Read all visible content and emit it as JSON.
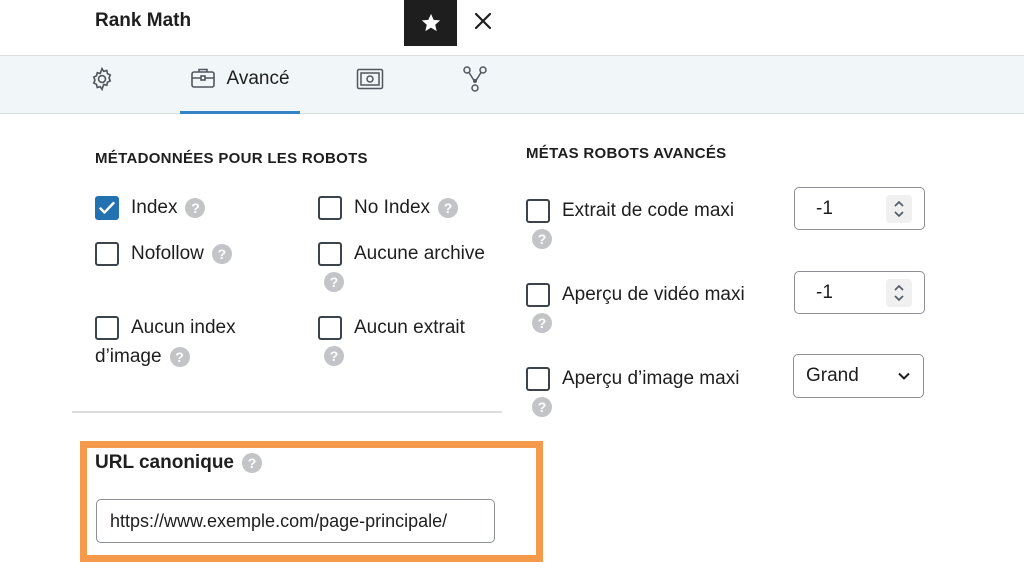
{
  "header": {
    "title": "Rank Math",
    "star_icon": "star-icon",
    "close_icon": "close-icon"
  },
  "tabs": [
    {
      "id": "general",
      "icon": "gear-icon",
      "label": ""
    },
    {
      "id": "advanced",
      "icon": "toolbox-icon",
      "label": "Avancé",
      "active": true
    },
    {
      "id": "schema",
      "icon": "schema-icon",
      "label": ""
    },
    {
      "id": "social",
      "icon": "social-share-icon",
      "label": ""
    }
  ],
  "robots_meta": {
    "heading": "MÉTADONNÉES POUR LES ROBOTS",
    "index": {
      "label": "Index",
      "checked": true
    },
    "noindex": {
      "label": "No Index",
      "checked": false
    },
    "nofollow": {
      "label": "Nofollow",
      "checked": false
    },
    "noarchive": {
      "label": "Aucune archive",
      "checked": false
    },
    "noimageindex": {
      "label_line1": "Aucun index",
      "label_line2": "d’image",
      "checked": false
    },
    "nosnippet": {
      "label": "Aucun extrait",
      "checked": false
    }
  },
  "advanced_robots": {
    "heading": "MÉTAS ROBOTS AVANCÉS",
    "max_snippet": {
      "label": "Extrait de code maxi",
      "value": "-1",
      "checked": false
    },
    "max_video_preview": {
      "label": "Aperçu de vidéo maxi",
      "value": "-1",
      "checked": false
    },
    "max_image_preview": {
      "label": "Aperçu d’image maxi",
      "value": "Grand",
      "checked": false
    }
  },
  "canonical": {
    "label": "URL canonique",
    "value": "https://www.exemple.com/page-principale/"
  },
  "colors": {
    "accent": "#2271b1",
    "tab_underline": "#3582c4",
    "highlight": "#f59a4a",
    "help_icon": "#c3c4c7"
  }
}
